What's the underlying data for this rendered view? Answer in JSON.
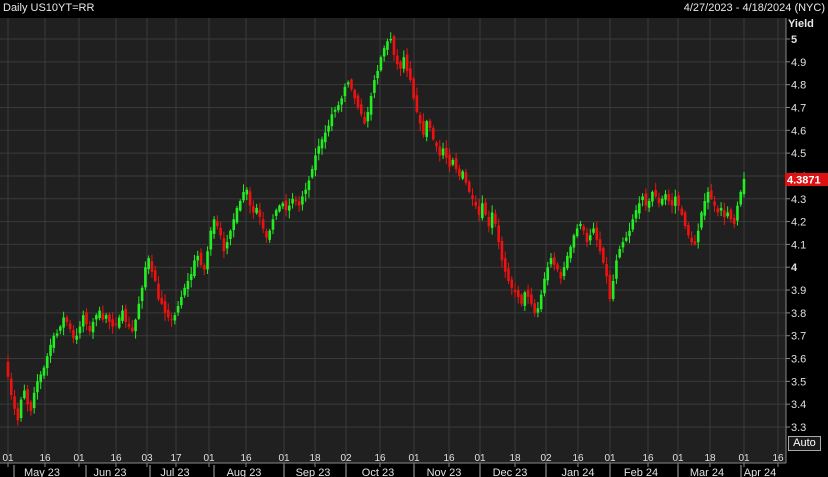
{
  "header": {
    "title": "Daily US10YT=RR",
    "date_range": "4/27/2023 - 4/18/2024 (NYC)"
  },
  "controls": {
    "auto_label": "Auto"
  },
  "colors": {
    "background": "#000000",
    "plot_bg": "#202020",
    "grid": "#3a3a3a",
    "up": "#22ee22",
    "down": "#ee1111",
    "last_price_bg": "#dd1111",
    "text": "#e0e0e0"
  },
  "chart_data": {
    "type": "candlestick",
    "ylabel": "Yield",
    "ylim": [
      3.25,
      5.05
    ],
    "yticks": [
      3.3,
      3.4,
      3.5,
      3.6,
      3.7,
      3.8,
      3.9,
      4,
      4.1,
      4.2,
      4.3,
      4.4,
      4.5,
      4.6,
      4.7,
      4.8,
      4.9,
      5
    ],
    "ytick_labels": [
      "3.3",
      "3.4",
      "3.5",
      "3.6",
      "3.7",
      "3.8",
      "3.9",
      "4",
      "4.1",
      "4.2",
      "4.3",
      "4.4",
      "4.5",
      "4.6",
      "4.7",
      "4.8",
      "4.9",
      "5"
    ],
    "grid": true,
    "last_price": "4.3871",
    "day_ticks": [
      "01",
      "16",
      "01",
      "16",
      "03",
      "17",
      "01",
      "16",
      "01",
      "18",
      "02",
      "16",
      "01",
      "16",
      "01",
      "18",
      "02",
      "16",
      "01",
      "16",
      "01",
      "18",
      "01",
      "16"
    ],
    "month_labels": [
      "May 23",
      "Jun 23",
      "Jul 23",
      "Aug 23",
      "Sep 23",
      "Oct 23",
      "Nov 23",
      "Dec 23",
      "Jan 24",
      "Feb 24",
      "Mar 24",
      "Apr 24"
    ],
    "close": [
      3.52,
      3.44,
      3.38,
      3.33,
      3.42,
      3.46,
      3.4,
      3.37,
      3.45,
      3.5,
      3.53,
      3.56,
      3.61,
      3.66,
      3.7,
      3.71,
      3.74,
      3.78,
      3.76,
      3.73,
      3.69,
      3.7,
      3.74,
      3.79,
      3.75,
      3.72,
      3.76,
      3.79,
      3.81,
      3.77,
      3.79,
      3.76,
      3.74,
      3.75,
      3.78,
      3.81,
      3.76,
      3.74,
      3.72,
      3.77,
      3.84,
      3.91,
      4.0,
      4.04,
      3.98,
      3.94,
      3.86,
      3.84,
      3.8,
      3.78,
      3.77,
      3.79,
      3.83,
      3.87,
      3.91,
      3.94,
      3.97,
      4.03,
      4.05,
      4.01,
      3.99,
      4.07,
      4.16,
      4.21,
      4.18,
      4.14,
      4.07,
      4.11,
      4.16,
      4.21,
      4.26,
      4.29,
      4.33,
      4.34,
      4.27,
      4.24,
      4.26,
      4.22,
      4.17,
      4.13,
      4.16,
      4.21,
      4.25,
      4.27,
      4.28,
      4.25,
      4.27,
      4.3,
      4.29,
      4.27,
      4.31,
      4.34,
      4.38,
      4.43,
      4.49,
      4.53,
      4.56,
      4.59,
      4.62,
      4.67,
      4.69,
      4.71,
      4.74,
      4.79,
      4.81,
      4.78,
      4.74,
      4.7,
      4.67,
      4.63,
      4.68,
      4.75,
      4.82,
      4.86,
      4.92,
      4.96,
      4.99,
      5.0,
      4.93,
      4.89,
      4.87,
      4.92,
      4.86,
      4.82,
      4.74,
      4.68,
      4.63,
      4.58,
      4.64,
      4.61,
      4.56,
      4.53,
      4.49,
      4.52,
      4.48,
      4.44,
      4.47,
      4.43,
      4.4,
      4.42,
      4.37,
      4.33,
      4.3,
      4.27,
      4.23,
      4.28,
      4.23,
      4.18,
      4.24,
      4.19,
      4.11,
      4.03,
      3.98,
      3.94,
      3.91,
      3.89,
      3.87,
      3.84,
      3.89,
      3.87,
      3.84,
      3.8,
      3.82,
      3.88,
      3.95,
      4.0,
      4.04,
      4.01,
      3.99,
      3.95,
      4.0,
      4.05,
      4.09,
      4.14,
      4.17,
      4.19,
      4.16,
      4.11,
      4.14,
      4.17,
      4.12,
      4.07,
      4.02,
      3.96,
      3.86,
      3.94,
      4.03,
      4.08,
      4.11,
      4.13,
      4.16,
      4.21,
      4.25,
      4.28,
      4.31,
      4.27,
      4.29,
      4.33,
      4.31,
      4.28,
      4.3,
      4.32,
      4.29,
      4.27,
      4.31,
      4.27,
      4.23,
      4.18,
      4.14,
      4.11,
      4.1,
      4.16,
      4.24,
      4.29,
      4.33,
      4.3,
      4.27,
      4.24,
      4.26,
      4.22,
      4.24,
      4.21,
      4.19,
      4.27,
      4.33,
      4.3871
    ]
  }
}
